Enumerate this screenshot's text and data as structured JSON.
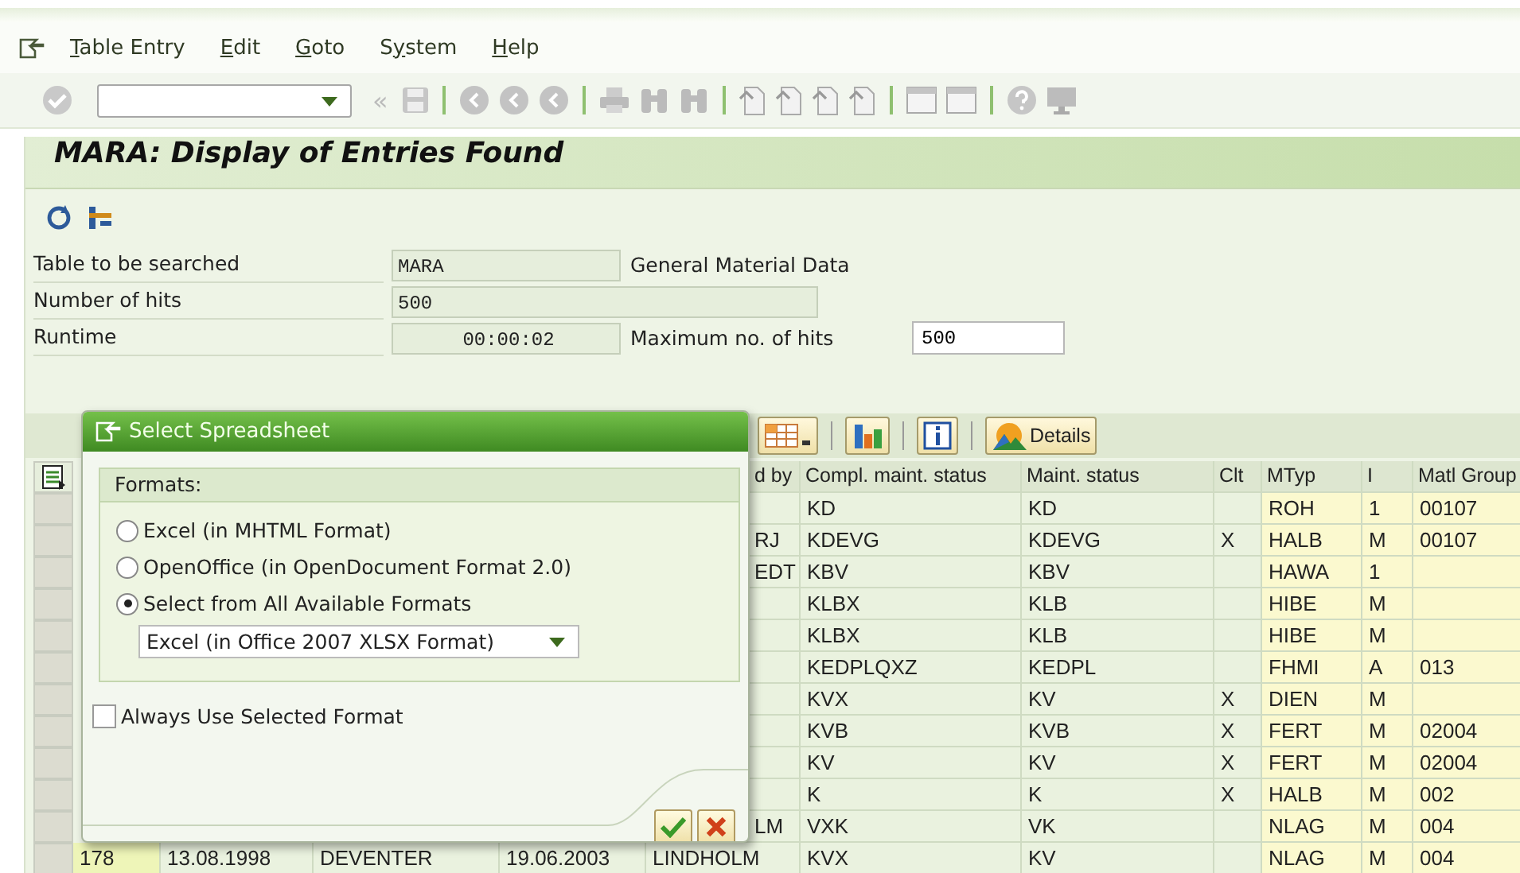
{
  "menu": [
    {
      "key": "T",
      "post": "able Entry"
    },
    {
      "key": "E",
      "post": "dit"
    },
    {
      "key": "G",
      "post": "oto"
    },
    {
      "pre": "S",
      "key": "y",
      "post": "stem"
    },
    {
      "key": "H",
      "post": "elp"
    }
  ],
  "toolbar": {
    "back_label": "«"
  },
  "title": "MARA: Display of Entries Found",
  "fields": [
    {
      "kind": "short",
      "label": "Table to be searched",
      "value": "MARA",
      "note": "General Material Data"
    },
    {
      "kind": "long",
      "label": "Number of hits",
      "value": "500"
    },
    {
      "kind": "short",
      "label": "Runtime",
      "value": "00:00:02",
      "note": "Maximum no. of hits",
      "input": "500"
    }
  ],
  "alv": {
    "details_label": "Details"
  },
  "table": {
    "columns": [
      null,
      null,
      null,
      null,
      "d by",
      "Compl. maint. status",
      "Maint. status",
      "Clt",
      "MTyp",
      "I",
      "Matl Group"
    ],
    "rows": [
      {
        "kind": "covered",
        "cells": [
          null,
          null,
          null,
          null,
          null,
          "KD",
          "KD",
          null,
          "ROH",
          "1",
          "00107"
        ]
      },
      {
        "kind": "covered",
        "cells": [
          null,
          null,
          null,
          null,
          "RJ",
          "KDEVG",
          "KDEVG",
          "X",
          "HALB",
          "M",
          "00107"
        ]
      },
      {
        "kind": "covered",
        "cells": [
          null,
          null,
          null,
          null,
          "EDT",
          "KBV",
          "KBV",
          null,
          "HAWA",
          "1",
          null
        ]
      },
      {
        "kind": "covered",
        "cells": [
          null,
          null,
          null,
          null,
          null,
          "KLBX",
          "KLB",
          null,
          "HIBE",
          "M",
          null
        ]
      },
      {
        "kind": "covered",
        "cells": [
          null,
          null,
          null,
          null,
          null,
          "KLBX",
          "KLB",
          null,
          "HIBE",
          "M",
          null
        ]
      },
      {
        "kind": "covered",
        "cells": [
          null,
          null,
          null,
          null,
          null,
          "KEDPLQXZ",
          "KEDPL",
          null,
          "FHMI",
          "A",
          "013"
        ]
      },
      {
        "kind": "covered",
        "cells": [
          null,
          null,
          null,
          null,
          null,
          "KVX",
          "KV",
          "X",
          "DIEN",
          "M",
          null
        ]
      },
      {
        "kind": "covered",
        "cells": [
          null,
          null,
          null,
          null,
          null,
          "KVB",
          "KVB",
          "X",
          "FERT",
          "M",
          "02004"
        ]
      },
      {
        "kind": "covered",
        "cells": [
          null,
          null,
          null,
          null,
          null,
          "KV",
          "KV",
          "X",
          "FERT",
          "M",
          "02004"
        ]
      },
      {
        "kind": "covered",
        "cells": [
          null,
          null,
          null,
          null,
          null,
          "K",
          "K",
          "X",
          "HALB",
          "M",
          "002"
        ]
      },
      {
        "kind": "covered",
        "cells": [
          null,
          null,
          null,
          null,
          "LM",
          "VXK",
          "VK",
          null,
          "NLAG",
          "M",
          "004"
        ]
      },
      {
        "kind": "full",
        "cells": [
          "178",
          "13.08.1998",
          "DEVENTER",
          "19.06.2003",
          "LINDHOLM",
          "KVX",
          "KV",
          null,
          "NLAG",
          "M",
          "004"
        ]
      }
    ]
  },
  "dialog": {
    "title": "Select Spreadsheet",
    "group_title": "Formats:",
    "options": [
      {
        "label": "Excel (in MHTML Format)",
        "selected": false
      },
      {
        "label": "OpenOffice (in OpenDocument Format 2.0)",
        "selected": false
      },
      {
        "label": "Select from All Available Formats",
        "selected": true
      }
    ],
    "format_dropdown": "Excel (in Office 2007 XLSX Format)",
    "always_use": {
      "label": "Always Use Selected Format",
      "checked": false
    }
  }
}
